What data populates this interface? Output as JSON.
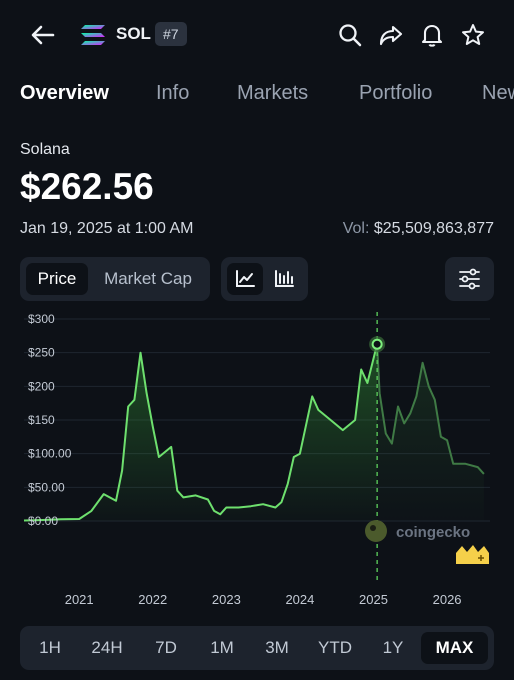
{
  "header": {
    "coin_symbol": "SOL",
    "rank_badge": "#7",
    "icons": [
      "back-arrow-icon",
      "solana-logo-icon",
      "search-icon",
      "share-icon",
      "bell-icon",
      "star-icon"
    ]
  },
  "tabs": [
    {
      "label": "Overview",
      "active": true
    },
    {
      "label": "Info",
      "active": false
    },
    {
      "label": "Markets",
      "active": false
    },
    {
      "label": "Portfolio",
      "active": false
    },
    {
      "label": "News",
      "active": false
    }
  ],
  "coin": {
    "name": "Solana",
    "price": "$262.56",
    "timestamp": "Jan 19, 2025 at 1:00 AM",
    "volume_label": "Vol:",
    "volume_value": "$25,509,863,877"
  },
  "chart_toggle": {
    "options": [
      "Price",
      "Market Cap"
    ],
    "selected": "Price",
    "view_icons": [
      "line-chart-icon",
      "candlestick-chart-icon"
    ],
    "selected_view": "line-chart-icon",
    "settings_icon": "sliders-icon"
  },
  "colors": {
    "background": "#0d1117",
    "line": "#6ee06e",
    "line_faded": "#3f7a45",
    "marker_line": "#5ed35e",
    "panel": "#1d232d"
  },
  "watermark": "coingecko",
  "chart_data": {
    "type": "area",
    "title": "",
    "xlabel": "",
    "ylabel": "",
    "y_ticks": [
      "$300",
      "$250",
      "$200",
      "$150",
      "$100.00",
      "$50.00",
      "$0.00"
    ],
    "ylim": [
      0,
      300
    ],
    "x_ticks": [
      "2021",
      "2022",
      "2023",
      "2024",
      "2025",
      "2026"
    ],
    "xlim": [
      "2020-04",
      "2026-08"
    ],
    "grid": true,
    "selected_point": {
      "x": "2025-01-19",
      "y": 262.56
    },
    "series": [
      {
        "x": [
          "2020-04",
          "2020-07",
          "2020-10",
          "2021-01",
          "2021-03",
          "2021-05",
          "2021-07",
          "2021-08",
          "2021-09",
          "2021-10",
          "2021-11",
          "2021-12",
          "2022-01",
          "2022-02",
          "2022-04",
          "2022-05",
          "2022-06",
          "2022-08",
          "2022-10",
          "2022-11",
          "2022-12",
          "2023-01",
          "2023-03",
          "2023-05",
          "2023-07",
          "2023-09",
          "2023-10",
          "2023-11",
          "2023-12",
          "2024-01",
          "2024-03",
          "2024-04",
          "2024-06",
          "2024-08",
          "2024-10",
          "2024-11",
          "2024-12",
          "2025-01-19"
        ],
        "values": [
          0.8,
          1.5,
          2.5,
          3,
          15,
          40,
          30,
          75,
          170,
          180,
          250,
          190,
          140,
          95,
          110,
          45,
          35,
          38,
          32,
          15,
          10,
          20,
          20,
          22,
          25,
          20,
          28,
          55,
          95,
          100,
          185,
          165,
          150,
          135,
          150,
          225,
          205,
          262.56
        ]
      },
      {
        "x": [
          "2025-01-19",
          "2025-02",
          "2025-03",
          "2025-04",
          "2025-05",
          "2025-06",
          "2025-07",
          "2025-08",
          "2025-09",
          "2025-10",
          "2025-11",
          "2025-12",
          "2026-01",
          "2026-02",
          "2026-04",
          "2026-06",
          "2026-07"
        ],
        "values": [
          262.56,
          190,
          130,
          115,
          170,
          145,
          160,
          185,
          235,
          200,
          180,
          125,
          120,
          85,
          85,
          80,
          70
        ],
        "style": "faded"
      }
    ]
  },
  "time_ranges": [
    "1H",
    "24H",
    "7D",
    "1M",
    "3M",
    "YTD",
    "1Y",
    "MAX"
  ],
  "selected_range": "MAX"
}
